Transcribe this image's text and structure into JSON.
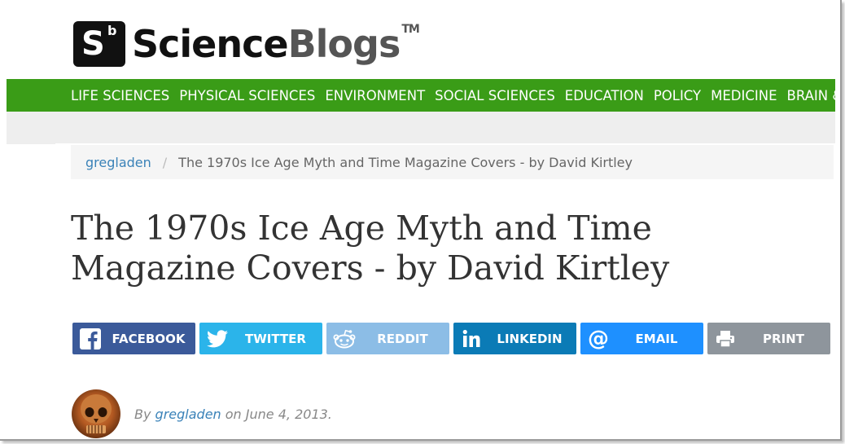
{
  "logo": {
    "box_letter": "S",
    "box_sup": "b",
    "word1": "Science",
    "word2": "Blogs",
    "tm": "TM"
  },
  "nav": {
    "items": [
      "LIFE SCIENCES",
      "PHYSICAL SCIENCES",
      "ENVIRONMENT",
      "SOCIAL SCIENCES",
      "EDUCATION",
      "POLICY",
      "MEDICINE",
      "BRAIN &"
    ]
  },
  "breadcrumb": {
    "link": "gregladen",
    "separator": "/",
    "current": "The 1970s Ice Age Myth and Time Magazine Covers - by David Kirtley"
  },
  "article": {
    "title_line1": "The 1970s Ice Age Myth and Time",
    "title_line2": "Magazine Covers - by David Kirtley"
  },
  "share": {
    "buttons": [
      {
        "label": "FACEBOOK",
        "icon": "facebook-icon",
        "color": "#3b5a9a"
      },
      {
        "label": "TWITTER",
        "icon": "twitter-icon",
        "color": "#2bb4ea"
      },
      {
        "label": "REDDIT",
        "icon": "reddit-icon",
        "color": "#8cbde6"
      },
      {
        "label": "LINKEDIN",
        "icon": "linkedin-icon",
        "color": "#0b7bb6"
      },
      {
        "label": "EMAIL",
        "icon": "email-icon",
        "color": "#1e90ff"
      },
      {
        "label": "PRINT",
        "icon": "print-icon",
        "color": "#8e959c"
      }
    ]
  },
  "byline": {
    "prefix": "By",
    "author": "gregladen",
    "on": "on",
    "date": "June 4, 2013."
  },
  "colors": {
    "nav_bg": "#3a9c17",
    "link": "#3a82b8"
  }
}
